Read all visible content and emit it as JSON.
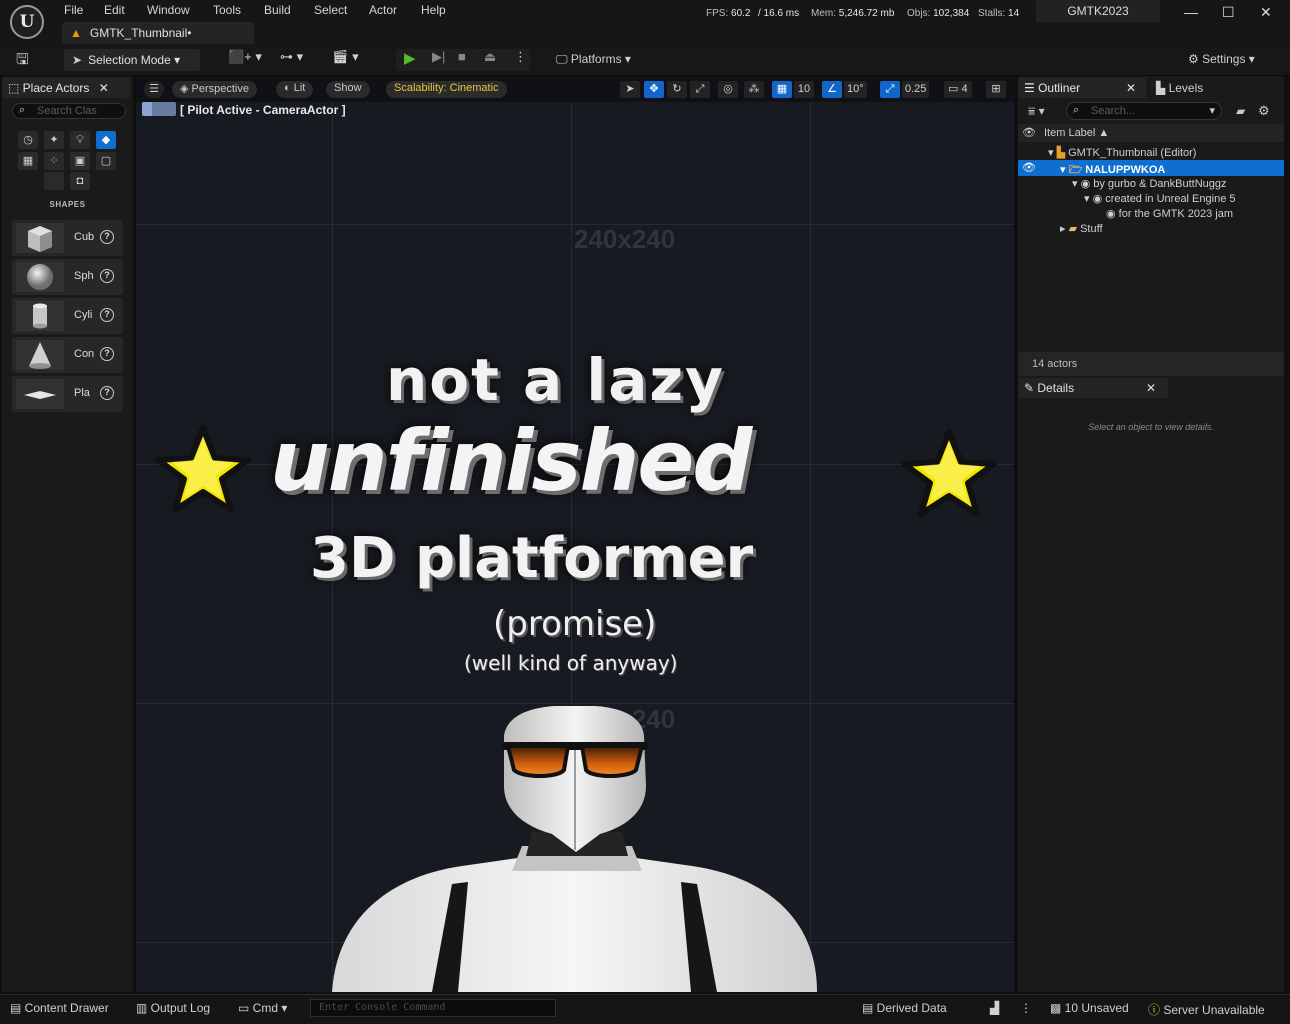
{
  "app": {
    "logo": "U",
    "document_tab": "GMTK_Thumbnail•",
    "project": "GMTK2023"
  },
  "menu": [
    "File",
    "Edit",
    "Window",
    "Tools",
    "Build",
    "Select",
    "Actor",
    "Help"
  ],
  "stats": {
    "fps_label": "FPS:",
    "fps": "60.2",
    "ms": "/ 16.6 ms",
    "mem_label": "Mem:",
    "mem": "5,246.72 mb",
    "objs_label": "Objs:",
    "objs": "102,384",
    "stalls_label": "Stalls:",
    "stalls": "14"
  },
  "toolbar": {
    "selection_mode": "Selection Mode",
    "platforms": "Platforms",
    "settings": "Settings"
  },
  "place_actors": {
    "tab": "Place Actors",
    "search_placeholder": "Search Clas",
    "shapes_label": "SHAPES",
    "shapes": [
      {
        "label": "Cub",
        "icon": "cube-icon"
      },
      {
        "label": "Sph",
        "icon": "sphere-icon"
      },
      {
        "label": "Cyli",
        "icon": "cylinder-icon"
      },
      {
        "label": "Con",
        "icon": "cone-icon"
      },
      {
        "label": "Pla",
        "icon": "plane-icon"
      }
    ]
  },
  "viewport": {
    "perspective": "Perspective",
    "lit": "Lit",
    "show": "Show",
    "scalability": "Scalability: Cinematic",
    "grid_snap": "10",
    "rot_snap": "10°",
    "scale_snap": "0.25",
    "cam_speed": "4",
    "pilot": "[ Pilot Active - CameraActor ]",
    "ghost_label_1": "240x240",
    "ghost_label_2": "240x240"
  },
  "thumbnail": {
    "line1": "not a lazy",
    "line2": "unfinished",
    "line3": "3D platformer",
    "line4": "(promise)",
    "line5": "(well kind of anyway)"
  },
  "outliner": {
    "tab": "Outliner",
    "levels_tab": "Levels",
    "search_placeholder": "Search...",
    "column": "Item Label ▲",
    "rows": [
      "GMTK_Thumbnail (Editor)",
      "NALUPPWKOA",
      "by gurbo & DankButtNuggz",
      "created in Unreal Engine 5",
      "for the GMTK 2023 jam",
      "Stuff"
    ],
    "actors_count": "14 actors"
  },
  "details": {
    "tab": "Details",
    "hint": "Select an object to view details."
  },
  "statusbar": {
    "content_drawer": "Content Drawer",
    "output_log": "Output Log",
    "cmd": "Cmd",
    "console_placeholder": "Enter Console Command",
    "derived_data": "Derived Data",
    "unsaved": "10 Unsaved",
    "server": "Server Unavailable"
  },
  "colors": {
    "accent": "#0f6fd1",
    "play": "#4fbf2c",
    "scalability": "#e8c63c",
    "warning": "#e8a200",
    "star": "#f2e600"
  }
}
